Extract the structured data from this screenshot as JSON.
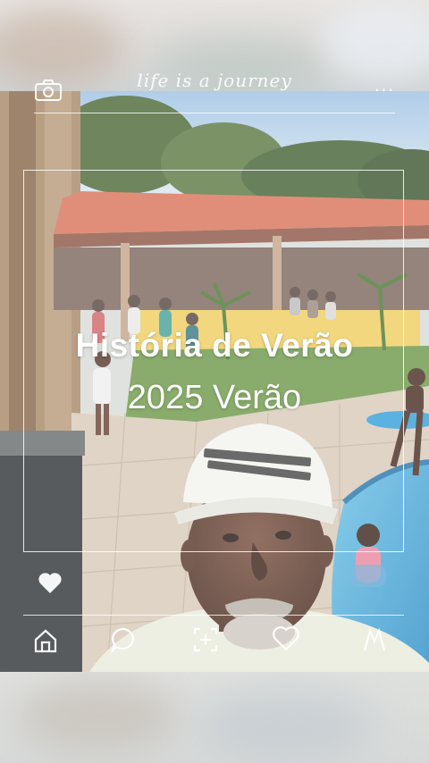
{
  "header": {
    "tagline": "life is a journey",
    "more_label": "..."
  },
  "overlay": {
    "title": "História de Verão",
    "subtitle": "2025 Verão"
  },
  "icons": {
    "camera": "camera-icon",
    "heart": "heart-icon",
    "home": "home-icon",
    "comment": "chat-bubble-icon",
    "add": "add-square-icon",
    "like": "heart-outline-icon",
    "profile": "profile-icon"
  },
  "colors": {
    "overlay_text": "#ffffff",
    "roof": "#e07a5f",
    "pool": "#3fa7d6",
    "wall": "#f1d36a"
  }
}
